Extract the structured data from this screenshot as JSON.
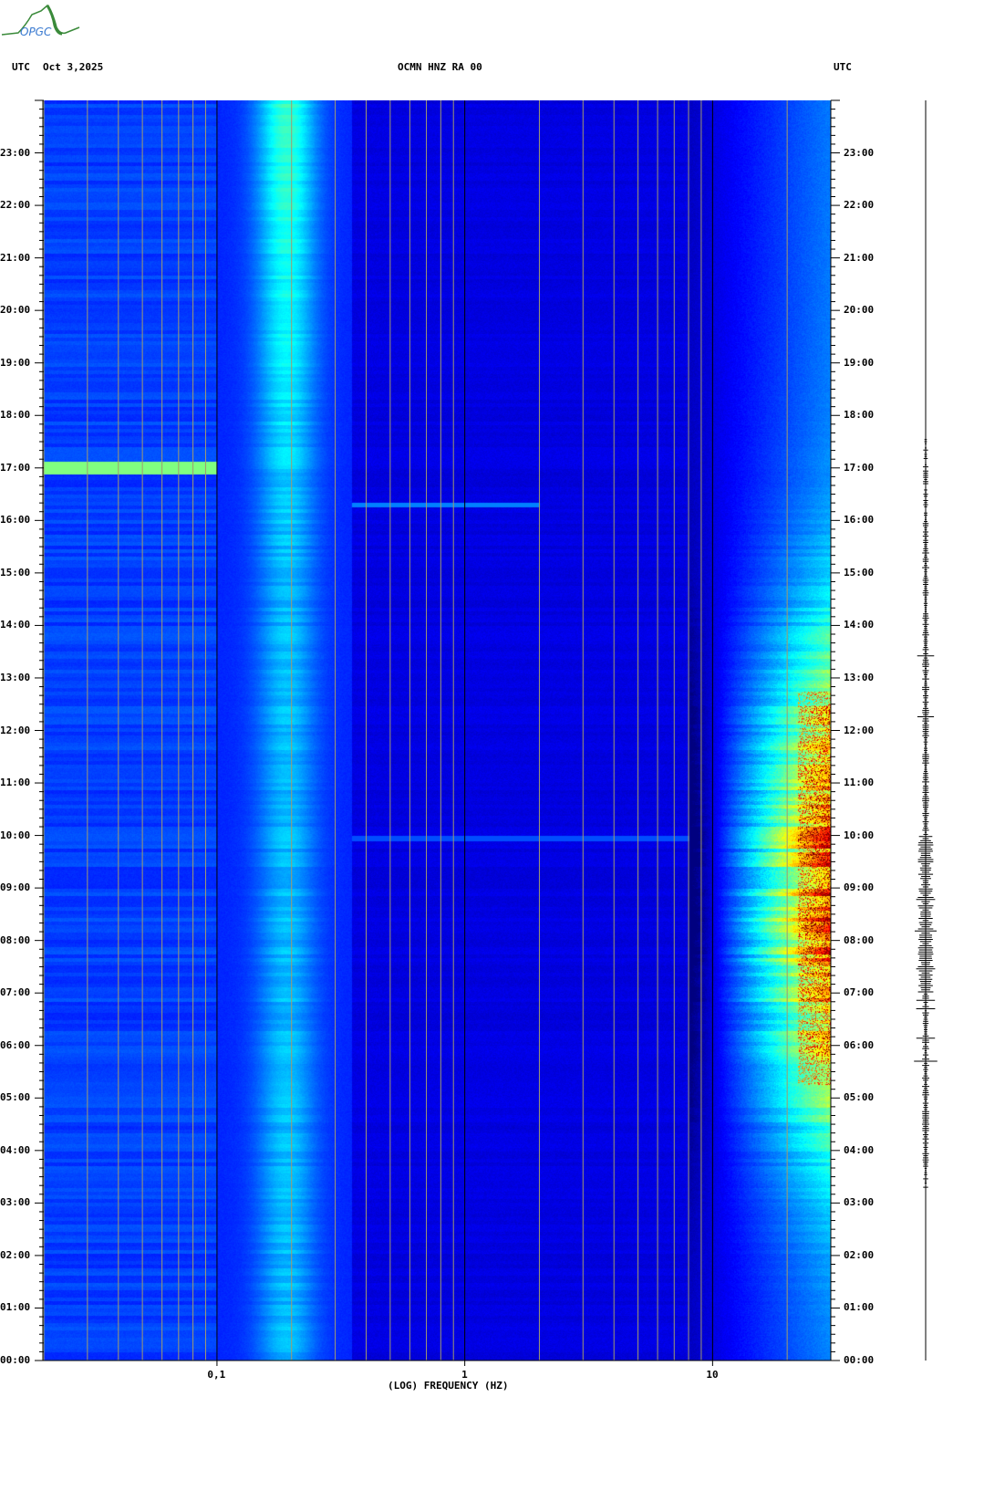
{
  "header": {
    "left_tz": "UTC",
    "date": "Oct 3,2025",
    "station": "OCMN HNZ RA 00",
    "right_tz": "UTC",
    "logo_text": "OPGC"
  },
  "chart_data": {
    "type": "heatmap",
    "title": "OCMN HNZ RA 00",
    "xlabel": "(LOG) FREQUENCY (HZ)",
    "ylabel": "UTC",
    "xscale": "log",
    "xlim": [
      0.02,
      30
    ],
    "x_tick_labels": [
      {
        "value": 0.1,
        "label": "0,1"
      },
      {
        "value": 1,
        "label": "1"
      },
      {
        "value": 10,
        "label": "10"
      }
    ],
    "ylim_hours": [
      0,
      24
    ],
    "y_tick_labels": [
      "00:00",
      "01:00",
      "02:00",
      "03:00",
      "04:00",
      "05:00",
      "06:00",
      "07:00",
      "08:00",
      "09:00",
      "10:00",
      "11:00",
      "12:00",
      "13:00",
      "14:00",
      "15:00",
      "16:00",
      "17:00",
      "18:00",
      "19:00",
      "20:00",
      "21:00",
      "22:00",
      "23:00"
    ],
    "colormap": "jet",
    "features": [
      {
        "name": "microseism band",
        "freq_range_hz": [
          0.14,
          0.3
        ],
        "level": "moderate, strongest 20:00-24:00"
      },
      {
        "name": "long-period event",
        "freq_range_hz": [
          0.02,
          0.1
        ],
        "time": "17:00",
        "level": "high"
      },
      {
        "name": "cultural noise",
        "freq_range_hz": [
          10,
          30
        ],
        "time_range": [
          "05:00",
          "18:00"
        ],
        "level": "high, peak 06:00-10:00 above 20 Hz"
      }
    ],
    "seismogram_trace": {
      "position": "right",
      "active_hours": [
        3.5,
        17.5
      ],
      "peak_hours": [
        7,
        10
      ]
    }
  }
}
